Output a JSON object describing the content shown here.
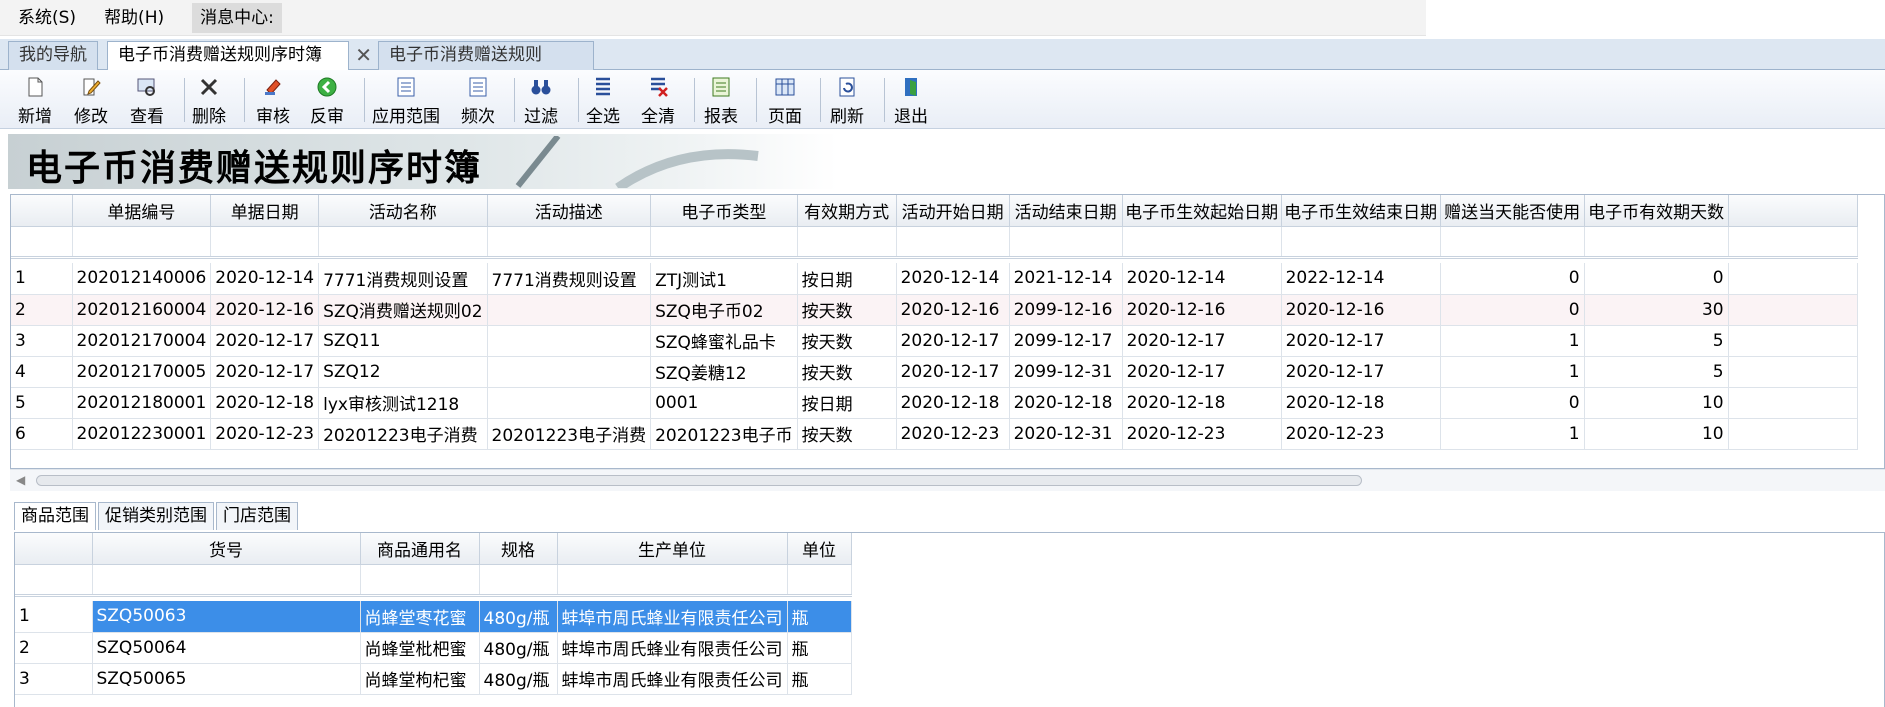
{
  "menu": [
    {
      "label": "系统(S)"
    },
    {
      "label": "帮助(H)"
    },
    {
      "label": "消息中心:"
    }
  ],
  "tabs": [
    {
      "label": "我的导航"
    },
    {
      "label": "电子币消费赠送规则序时簿",
      "close": "✕"
    },
    {
      "label": "电子币消费赠送规则"
    }
  ],
  "toolbar": {
    "new": "新增",
    "edit": "修改",
    "view": "查看",
    "delete": "删除",
    "audit": "审核",
    "unaudit": "反审",
    "scope": "应用范围",
    "frequency": "频次",
    "filter": "过滤",
    "select_all": "全选",
    "clear_all": "全清",
    "report": "报表",
    "page": "页面",
    "refresh": "刷新",
    "exit": "退出"
  },
  "banner": {
    "title": "电子币消费赠送规则序时簿"
  },
  "main_table": {
    "headers": [
      "单据编号",
      "单据日期",
      "活动名称",
      "活动描述",
      "电子币类型",
      "有效期方式",
      "活动开始日期",
      "活动结束日期",
      "电子币生效起始日期",
      "电子币生效结束日期",
      "赠送当天能否使用",
      "电子币有效期天数"
    ],
    "rows": [
      [
        "1",
        "202012140006",
        "2020-12-14",
        "7771消费规则设置",
        "7771消费规则设置",
        "ZTJ测试1",
        "按日期",
        "2020-12-14",
        "2021-12-14",
        "2020-12-14",
        "2022-12-14",
        "0",
        "0"
      ],
      [
        "2",
        "202012160004",
        "2020-12-16",
        "SZQ消费赠送规则02",
        "",
        "SZQ电子币02",
        "按天数",
        "2020-12-16",
        "2099-12-16",
        "2020-12-16",
        "2020-12-16",
        "0",
        "30"
      ],
      [
        "3",
        "202012170004",
        "2020-12-17",
        "SZQ11",
        "",
        "SZQ蜂蜜礼品卡",
        "按天数",
        "2020-12-17",
        "2099-12-17",
        "2020-12-17",
        "2020-12-17",
        "1",
        "5"
      ],
      [
        "4",
        "202012170005",
        "2020-12-17",
        "SZQ12",
        "",
        "SZQ姜糖12",
        "按天数",
        "2020-12-17",
        "2099-12-31",
        "2020-12-17",
        "2020-12-17",
        "1",
        "5"
      ],
      [
        "5",
        "202012180001",
        "2020-12-18",
        "lyx审核测试1218",
        "",
        "0001",
        "按日期",
        "2020-12-18",
        "2020-12-18",
        "2020-12-18",
        "2020-12-18",
        "0",
        "10"
      ],
      [
        "6",
        "202012230001",
        "2020-12-23",
        "20201223电子消费",
        "20201223电子消费",
        "20201223电子币",
        "按天数",
        "2020-12-23",
        "2020-12-31",
        "2020-12-23",
        "2020-12-23",
        "1",
        "10"
      ]
    ]
  },
  "sub_tabs": [
    {
      "label": "商品范围"
    },
    {
      "label": "促销类别范围"
    },
    {
      "label": "门店范围"
    }
  ],
  "detail_table": {
    "headers": [
      "货号",
      "商品通用名",
      "规格",
      "生产单位",
      "单位"
    ],
    "rows": [
      [
        "1",
        "SZQ50063",
        "尚蜂堂枣花蜜",
        "480g/瓶",
        "蚌埠市周氏蜂业有限责任公司",
        "瓶"
      ],
      [
        "2",
        "SZQ50064",
        "尚蜂堂枇杷蜜",
        "480g/瓶",
        "蚌埠市周氏蜂业有限责任公司",
        "瓶"
      ],
      [
        "3",
        "SZQ50065",
        "尚蜂堂枸杞蜜",
        "480g/瓶",
        "蚌埠市周氏蜂业有限责任公司",
        "瓶"
      ]
    ]
  }
}
